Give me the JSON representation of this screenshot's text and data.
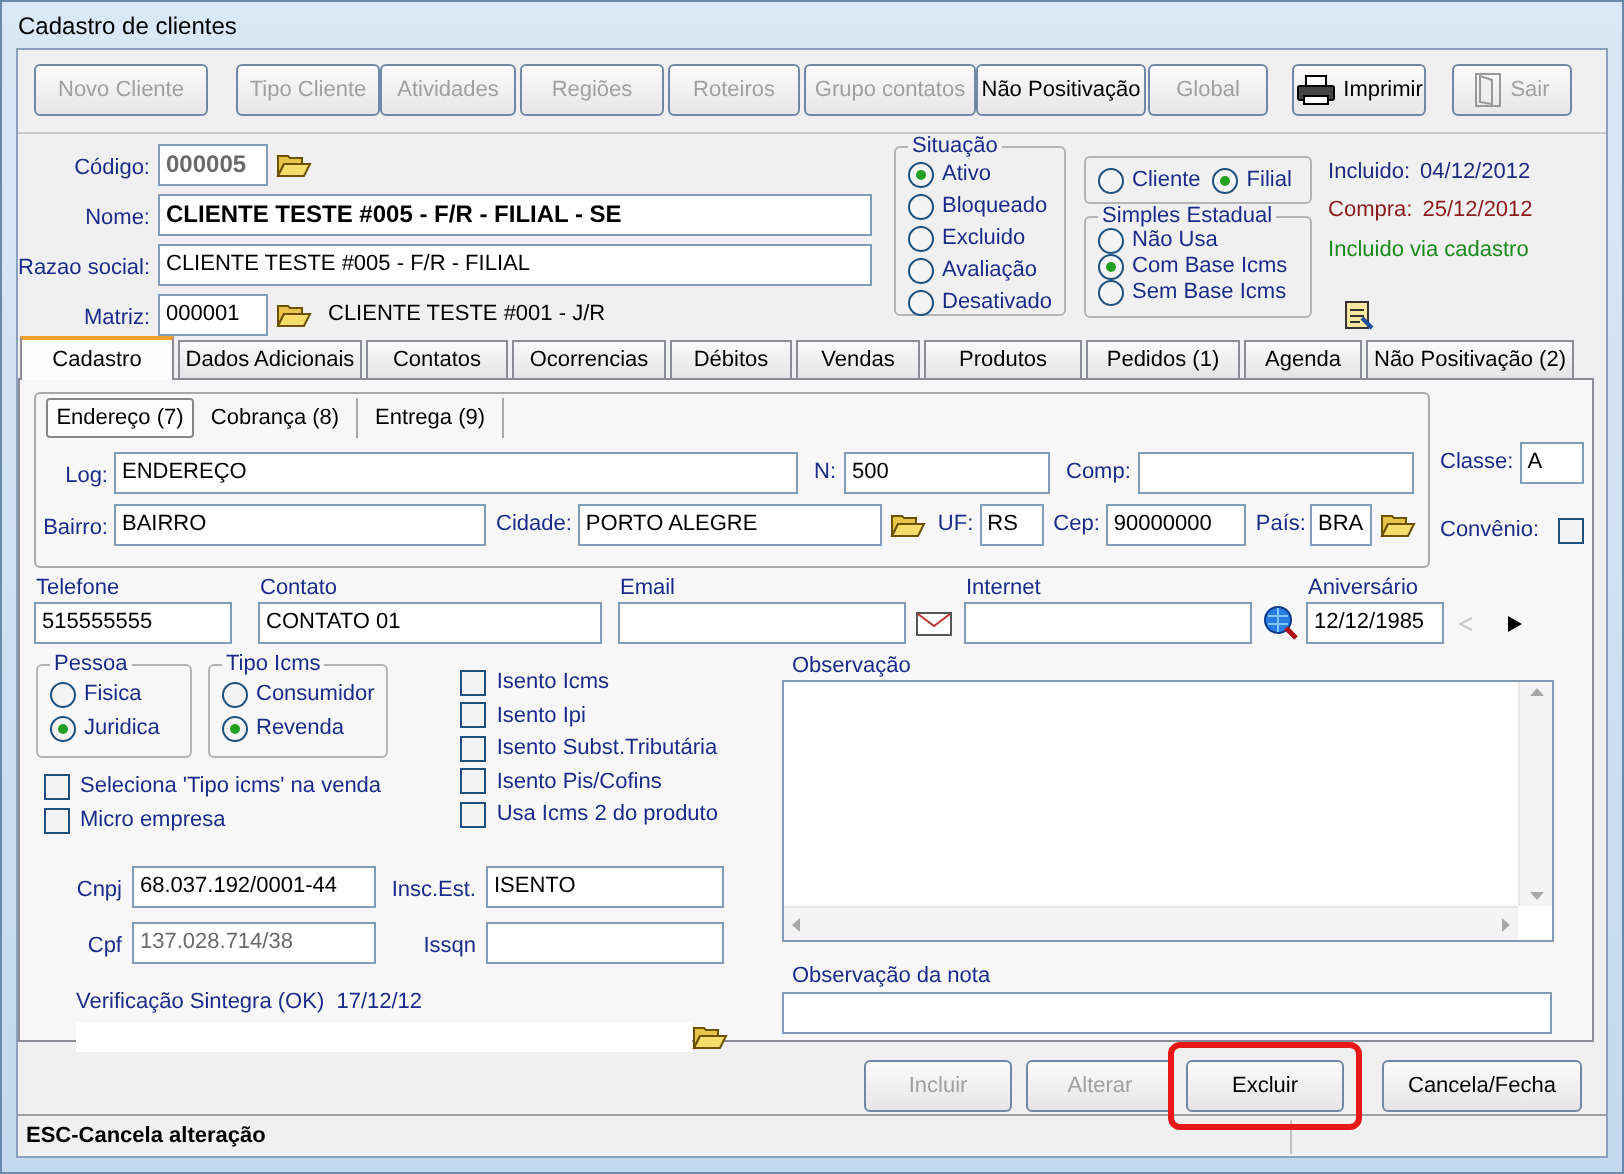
{
  "window": {
    "title": "Cadastro de clientes"
  },
  "toolbar": [
    {
      "label": "Novo Cliente",
      "disabled": true,
      "kind": "text"
    },
    {
      "label": "Tipo Cliente",
      "disabled": true,
      "kind": "text"
    },
    {
      "label": "Atividades",
      "disabled": true,
      "kind": "text"
    },
    {
      "label": "Regiões",
      "disabled": true,
      "kind": "text"
    },
    {
      "label": "Roteiros",
      "disabled": true,
      "kind": "text"
    },
    {
      "label": "Grupo contatos",
      "disabled": true,
      "kind": "text"
    },
    {
      "label": "Não Positivação",
      "disabled": false,
      "kind": "text"
    },
    {
      "label": "Global",
      "disabled": true,
      "kind": "text"
    },
    {
      "label": "Imprimir",
      "disabled": false,
      "kind": "print"
    },
    {
      "label": "Sair",
      "disabled": true,
      "kind": "exit"
    }
  ],
  "header": {
    "codigo": {
      "label": "Código:",
      "value": "000005",
      "disabled": true
    },
    "nome": {
      "label": "Nome:",
      "value": "CLIENTE TESTE #005 - F/R - FILIAL - SE"
    },
    "razao_social": {
      "label": "Razao social:",
      "value": "CLIENTE TESTE #005 - F/R - FILIAL"
    },
    "matriz": {
      "label": "Matriz:",
      "value": "000001",
      "description": "CLIENTE TESTE #001 - J/R"
    }
  },
  "situacao": {
    "title": "Situação",
    "options": [
      {
        "label": "Ativo",
        "selected": true
      },
      {
        "label": "Bloqueado",
        "selected": false
      },
      {
        "label": "Excluido",
        "selected": false
      },
      {
        "label": "Avaliação",
        "selected": false
      },
      {
        "label": "Desativado",
        "selected": false
      }
    ]
  },
  "tipo_cadastro": {
    "options": [
      {
        "label": "Cliente",
        "selected": false
      },
      {
        "label": "Filial",
        "selected": true
      }
    ]
  },
  "simples_estadual": {
    "title": "Simples Estadual",
    "options": [
      {
        "label": "Não Usa",
        "selected": false
      },
      {
        "label": "Com Base Icms",
        "selected": true
      },
      {
        "label": "Sem Base Icms",
        "selected": false
      }
    ]
  },
  "info": [
    {
      "label": "Incluido:",
      "value": "04/12/2012",
      "color": "#1f2a80"
    },
    {
      "label": "Compra:",
      "value": "25/12/2012",
      "color": "#8b1a1a"
    }
  ],
  "note": "Incluido via cadastro",
  "tabs": [
    {
      "label": "Cadastro",
      "selected": true
    },
    {
      "label": "Dados Adicionais",
      "selected": false
    },
    {
      "label": "Contatos",
      "selected": false
    },
    {
      "label": "Ocorrencias",
      "selected": false
    },
    {
      "label": "Débitos",
      "selected": false
    },
    {
      "label": "Vendas",
      "selected": false
    },
    {
      "label": "Produtos",
      "selected": false
    },
    {
      "label": "Pedidos (1)",
      "selected": false
    },
    {
      "label": "Agenda",
      "selected": false
    },
    {
      "label": "Não Positivação (2)",
      "selected": false
    }
  ],
  "address_tabs": [
    {
      "label": "Endereço (7)",
      "selected": true
    },
    {
      "label": "Cobrança (8)",
      "selected": false
    },
    {
      "label": "Entrega (9)",
      "selected": false
    }
  ],
  "address": {
    "log": {
      "label": "Log:",
      "value": "ENDEREÇO"
    },
    "n": {
      "label": "N:",
      "value": "500"
    },
    "comp": {
      "label": "Comp:"
    },
    "bairro": {
      "label": "Bairro:",
      "value": "BAIRRO"
    },
    "cidade": {
      "label": "Cidade:",
      "value": "PORTO ALEGRE"
    },
    "uf": {
      "label": "UF:",
      "value": "RS"
    },
    "cep": {
      "label": "Cep:",
      "value": "90000000"
    },
    "pais": {
      "label": "País:",
      "value": "BRA"
    }
  },
  "classe": {
    "label": "Classe:",
    "value": "A"
  },
  "convenio": {
    "label": "Convênio:",
    "checked": false
  },
  "contact": {
    "telefone": {
      "label": "Telefone",
      "value": "515555555"
    },
    "contato": {
      "label": "Contato",
      "value": "CONTATO 01"
    },
    "email": {
      "label": "Email"
    },
    "internet": {
      "label": "Internet"
    },
    "aniversario": {
      "label": "Aniversário",
      "value": "12/12/1985"
    }
  },
  "pessoa": {
    "title": "Pessoa",
    "options": [
      {
        "label": "Fisica",
        "selected": false
      },
      {
        "label": "Juridica",
        "selected": true
      }
    ]
  },
  "tipo_icms": {
    "title": "Tipo Icms",
    "options": [
      {
        "label": "Consumidor",
        "selected": false
      },
      {
        "label": "Revenda",
        "selected": true
      }
    ]
  },
  "flags": [
    {
      "label": "Isento Icms",
      "checked": false
    },
    {
      "label": "Isento Ipi",
      "checked": false
    },
    {
      "label": "Isento Subst.Tributária",
      "checked": false
    },
    {
      "label": "Isento Pis/Cofins",
      "checked": false
    },
    {
      "label": "Usa Icms 2 do produto",
      "checked": false
    }
  ],
  "options": [
    {
      "label": "Seleciona 'Tipo icms' na venda",
      "checked": false
    },
    {
      "label": "Micro empresa",
      "checked": false
    }
  ],
  "documents": {
    "cnpj": {
      "label": "Cnpj",
      "value": "68.037.192/0001-44"
    },
    "insc_est": {
      "label": "Insc.Est.",
      "value": "ISENTO"
    },
    "cpf": {
      "label": "Cpf",
      "value": "137.028.714/38",
      "disabled": true
    },
    "issqn": {
      "label": "Issqn"
    }
  },
  "sintegra": {
    "label": "Verificação Sintegra (OK)  17/12/12"
  },
  "observacao": {
    "label": "Observação"
  },
  "observacao_nota": {
    "label": "Observação da nota"
  },
  "actions": [
    {
      "label": "Incluir",
      "disabled": true,
      "highlighted": false
    },
    {
      "label": "Alterar",
      "disabled": true,
      "highlighted": false
    },
    {
      "label": "Excluir",
      "disabled": false,
      "highlighted": true
    },
    {
      "label": "Cancela/Fecha",
      "disabled": false,
      "highlighted": false
    }
  ],
  "status_bar": "ESC-Cancela alteração"
}
